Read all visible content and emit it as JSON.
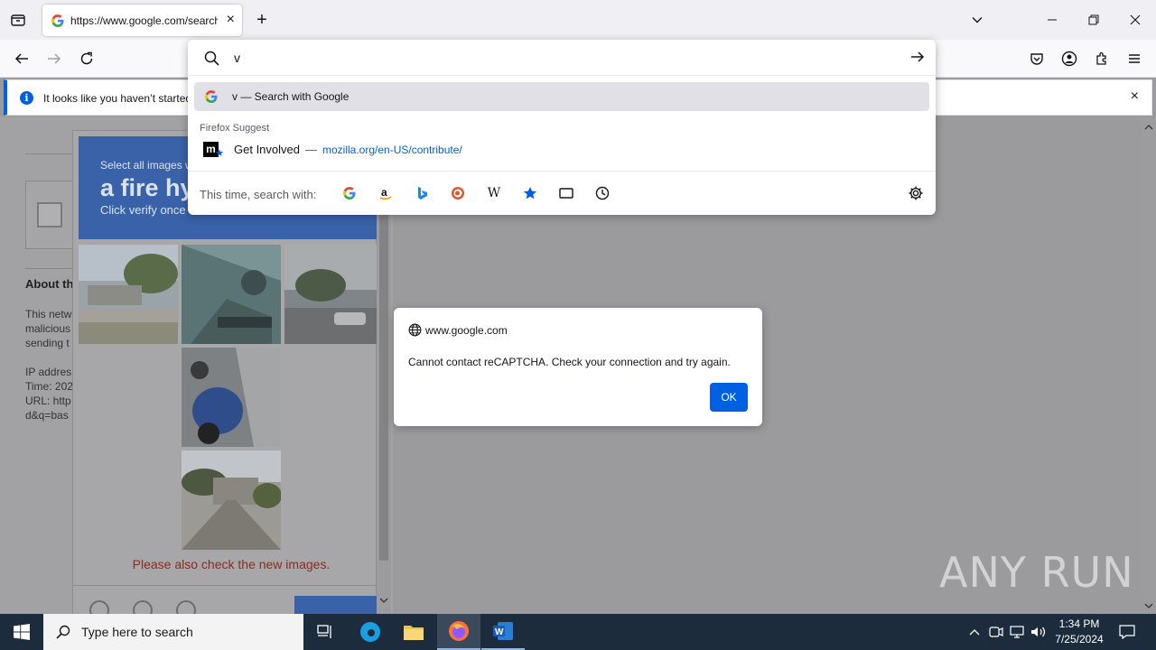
{
  "browser": {
    "tab": {
      "title": "https://www.google.com/search",
      "icon": "google-g-icon"
    },
    "new_tab_label": "+",
    "close_glyph": "×"
  },
  "notification": {
    "text": "It looks like you haven’t started",
    "close_glyph": "×"
  },
  "urlbar": {
    "typed": "v",
    "primary_result": "v — Search with Google",
    "suggest_heading": "Firefox Suggest",
    "suggestion": {
      "title": "Get Involved",
      "separator": "—",
      "url": "mozilla.org/en-US/contribute/"
    },
    "oneoff_label": "This time, search with:",
    "engines": [
      "google",
      "amazon",
      "bing",
      "duckduckgo",
      "wikipedia",
      "bookmarks",
      "tabs",
      "history"
    ],
    "wiki_glyph": "W"
  },
  "page": {
    "about_heading": "About th",
    "paragraph_lines": [
      "This netw",
      "malicious",
      "sending t",
      "",
      "IP addres",
      "Time: 202",
      "URL: http",
      "d&q=bas"
    ],
    "captcha": {
      "select_text": "Select all images w",
      "target": "a fire hy",
      "instruction": "Click verify once",
      "new_images_text": "Please also check the new images."
    }
  },
  "dialog": {
    "site": "www.google.com",
    "message": "Cannot contact reCAPTCHA. Check your connection and try again.",
    "ok_label": "OK"
  },
  "watermark": "ANY RUN",
  "taskbar": {
    "search_placeholder": "Type here to search",
    "time": "1:34 PM",
    "date": "7/25/2024"
  }
}
